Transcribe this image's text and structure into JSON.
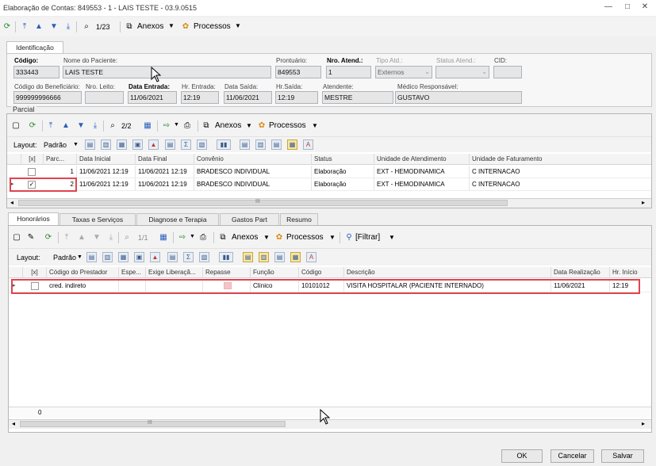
{
  "window": {
    "title": "Elaboração de Contas: 849553 - 1 - LAIS TESTE - 03.9.0515"
  },
  "top_toolbar": {
    "page": "1/23",
    "anexos": "Anexos",
    "processos": "Processos"
  },
  "ident_tab": "Identificação",
  "identificacao": {
    "codigo_label": "Código:",
    "codigo": "333443",
    "nome_label": "Nome do Paciente:",
    "nome": "LAIS TESTE",
    "prontuario_label": "Prontuário:",
    "prontuario": "849553",
    "nro_atend_label": "Nro. Atend.:",
    "nro_atend": "1",
    "tipo_atd_label": "Tipo Atd.:",
    "tipo_atd": "Externos",
    "status_atend_label": "Status Atend.:",
    "status_atend": "",
    "cid_label": "CID:",
    "cid": "",
    "cod_benef_label": "Código do Beneficiário:",
    "cod_benef": "999999996666",
    "nro_leito_label": "Nro. Leito:",
    "nro_leito": "",
    "data_entrada_label": "Data Entrada:",
    "data_entrada": "11/06/2021",
    "hr_entrada_label": "Hr. Entrada:",
    "hr_entrada": "12:19",
    "data_saida_label": "Data Saída:",
    "data_saida": "11/06/2021",
    "hr_saida_label": "Hr.Saída:",
    "hr_saida": "12:19",
    "atendente_label": "Atendente:",
    "atendente": "MESTRE",
    "medico_label": "Médico Responsável:",
    "medico": "GUSTAVO"
  },
  "parcial": {
    "legend": "Parcial",
    "page": "2/2",
    "anexos": "Anexos",
    "processos": "Processos",
    "layout_label": "Layout:",
    "padrao": "Padrão",
    "headers": [
      "[x]",
      "Parc...",
      "Data Inicial",
      "Data Final",
      "Convênio",
      "Status",
      "Unidade de Atendimento",
      "Unidade de Faturamento"
    ],
    "rows": [
      {
        "checked": false,
        "parc": "1",
        "data_inicial": "11/06/2021 12:19",
        "data_final": "11/06/2021 12:19",
        "convenio": "BRADESCO INDIVIDUAL",
        "status": "Elaboração",
        "unid_atend": "EXT - HEMODINAMICA",
        "unid_fat": "C INTERNACAO"
      },
      {
        "checked": true,
        "parc": "2",
        "data_inicial": "11/06/2021 12:19",
        "data_final": "11/06/2021 12:19",
        "convenio": "BRADESCO INDIVIDUAL",
        "status": "Elaboração",
        "unid_atend": "EXT - HEMODINAMICA",
        "unid_fat": "C INTERNACAO"
      }
    ],
    "scroll_mark": "III"
  },
  "bottom_tabs": [
    "Honorários",
    "Taxas e Serviços",
    "Diagnose e Terapia",
    "Gastos Part",
    "Resumo"
  ],
  "honorarios": {
    "page": "1/1",
    "anexos": "Anexos",
    "processos": "Processos",
    "filtrar": "[Filtrar]",
    "layout_label": "Layout:",
    "padrao": "Padrão",
    "headers": [
      "[x]",
      "Código do Prestador",
      "Espe...",
      "Exige Liberaçã...",
      "Repasse",
      "Função",
      "Código",
      "Descrição",
      "Data Realização",
      "Hr. Início"
    ],
    "rows": [
      {
        "prestador": "cred. indireto",
        "espe": "",
        "exige": "",
        "repasse": "",
        "funcao": "Clínico",
        "codigo": "10101012",
        "descricao": "VISITA HOSPITALAR (PACIENTE INTERNADO)",
        "data": "11/06/2021",
        "hora": "12:19"
      }
    ],
    "footer_count": "0",
    "scroll_mark": "III"
  },
  "buttons": {
    "ok": "OK",
    "cancelar": "Cancelar",
    "salvar": "Salvar"
  },
  "colors": {
    "highlight": "#e0444f",
    "field_bg": "#e6e6e6"
  }
}
